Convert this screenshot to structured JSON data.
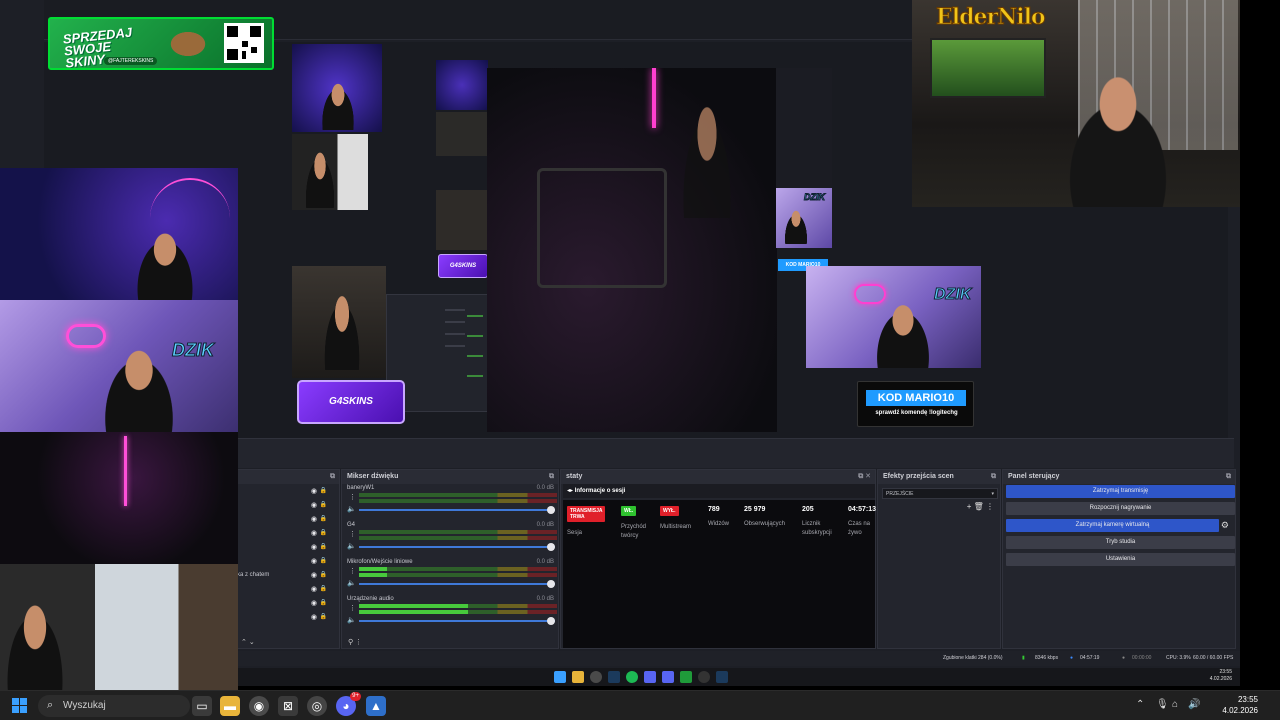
{
  "overlays": {
    "ad_banner": {
      "title": "SPRZEDAJ SWOJE SKINY",
      "handle": "@FAJTEREKSKINS"
    },
    "streamer_logo": "ElderNilo",
    "dzik_logo": "DZIK",
    "g4skins_large": "G4SKINS",
    "g4skins_small": "G4SKINS",
    "code_title": "KOD MARIO10",
    "code_subtitle": "sprawdź komendę !logitechg",
    "code_small": "KOD MARIO10"
  },
  "obs": {
    "sources": {
      "title": "",
      "items": [
        {
          "label": ""
        },
        {
          "label": ""
        },
        {
          "label": ""
        },
        {
          "label": ""
        },
        {
          "label": ""
        },
        {
          "label": ""
        },
        {
          "label": "ka z chatem"
        },
        {
          "label": ""
        },
        {
          "label": ""
        },
        {
          "label": ""
        }
      ]
    },
    "mixer": {
      "title": "Mikser dźwięku",
      "channels": [
        {
          "name": "baneryW1",
          "db": "0.0 dB",
          "level": 0
        },
        {
          "name": "G4",
          "db": "0.0 dB",
          "level": 0
        },
        {
          "name": "Mikrofon/Wejście liniowe",
          "db": "0.0 dB",
          "level": 0.14
        },
        {
          "name": "Urządzenie audio",
          "db": "0.0 dB",
          "level": 0.55
        }
      ],
      "scale": "-60 -55 -50 -45 -40 -35 -30 -25 -20 -15 -10 -5 0"
    },
    "stats": {
      "title": "staty",
      "session_title": "Informacje o sesji",
      "transmission_pill": "TRANSMISJA TRWA",
      "transmission_label": "Sesja",
      "revenue_pill": "WŁ.",
      "revenue_label": "Przychód twórcy",
      "multistream_pill": "WYŁ.",
      "multistream_label": "Multistream",
      "viewers_value": "789",
      "viewers_label": "Widzów",
      "followers_value": "25 979",
      "followers_label": "Obserwujących",
      "subs_value": "205",
      "subs_label": "Licznik subskrypcji",
      "live_value": "04:57:13",
      "live_label": "Czas na żywo"
    },
    "transitions": {
      "title": "Efekty przejścia scen",
      "selected": "PRZEJŚCIE"
    },
    "controls": {
      "title": "Panel sterujący",
      "stop_stream": "Zatrzymaj transmisję",
      "start_record": "Rozpocznij nagrywanie",
      "stop_virtualcam": "Zatrzymaj kamerę wirtualną",
      "studio_mode": "Tryb studia",
      "settings": "Ustawienia"
    },
    "statusbar": {
      "dropped": "Zgubione klatki 284 (0.0%)",
      "bitrate": "8346 kbps",
      "stream_time": "04:57:19",
      "record_time": "00:00:00",
      "cpu": "CPU: 3.9%",
      "fps": "60.00 / 60.00 FPS"
    },
    "inner_clock": {
      "time": "23:55",
      "date": "4.02.2026"
    }
  },
  "taskbar": {
    "search_placeholder": "Wyszukaj",
    "time": "23:55",
    "date": "4.02.2026",
    "discord_badge": "9+"
  }
}
